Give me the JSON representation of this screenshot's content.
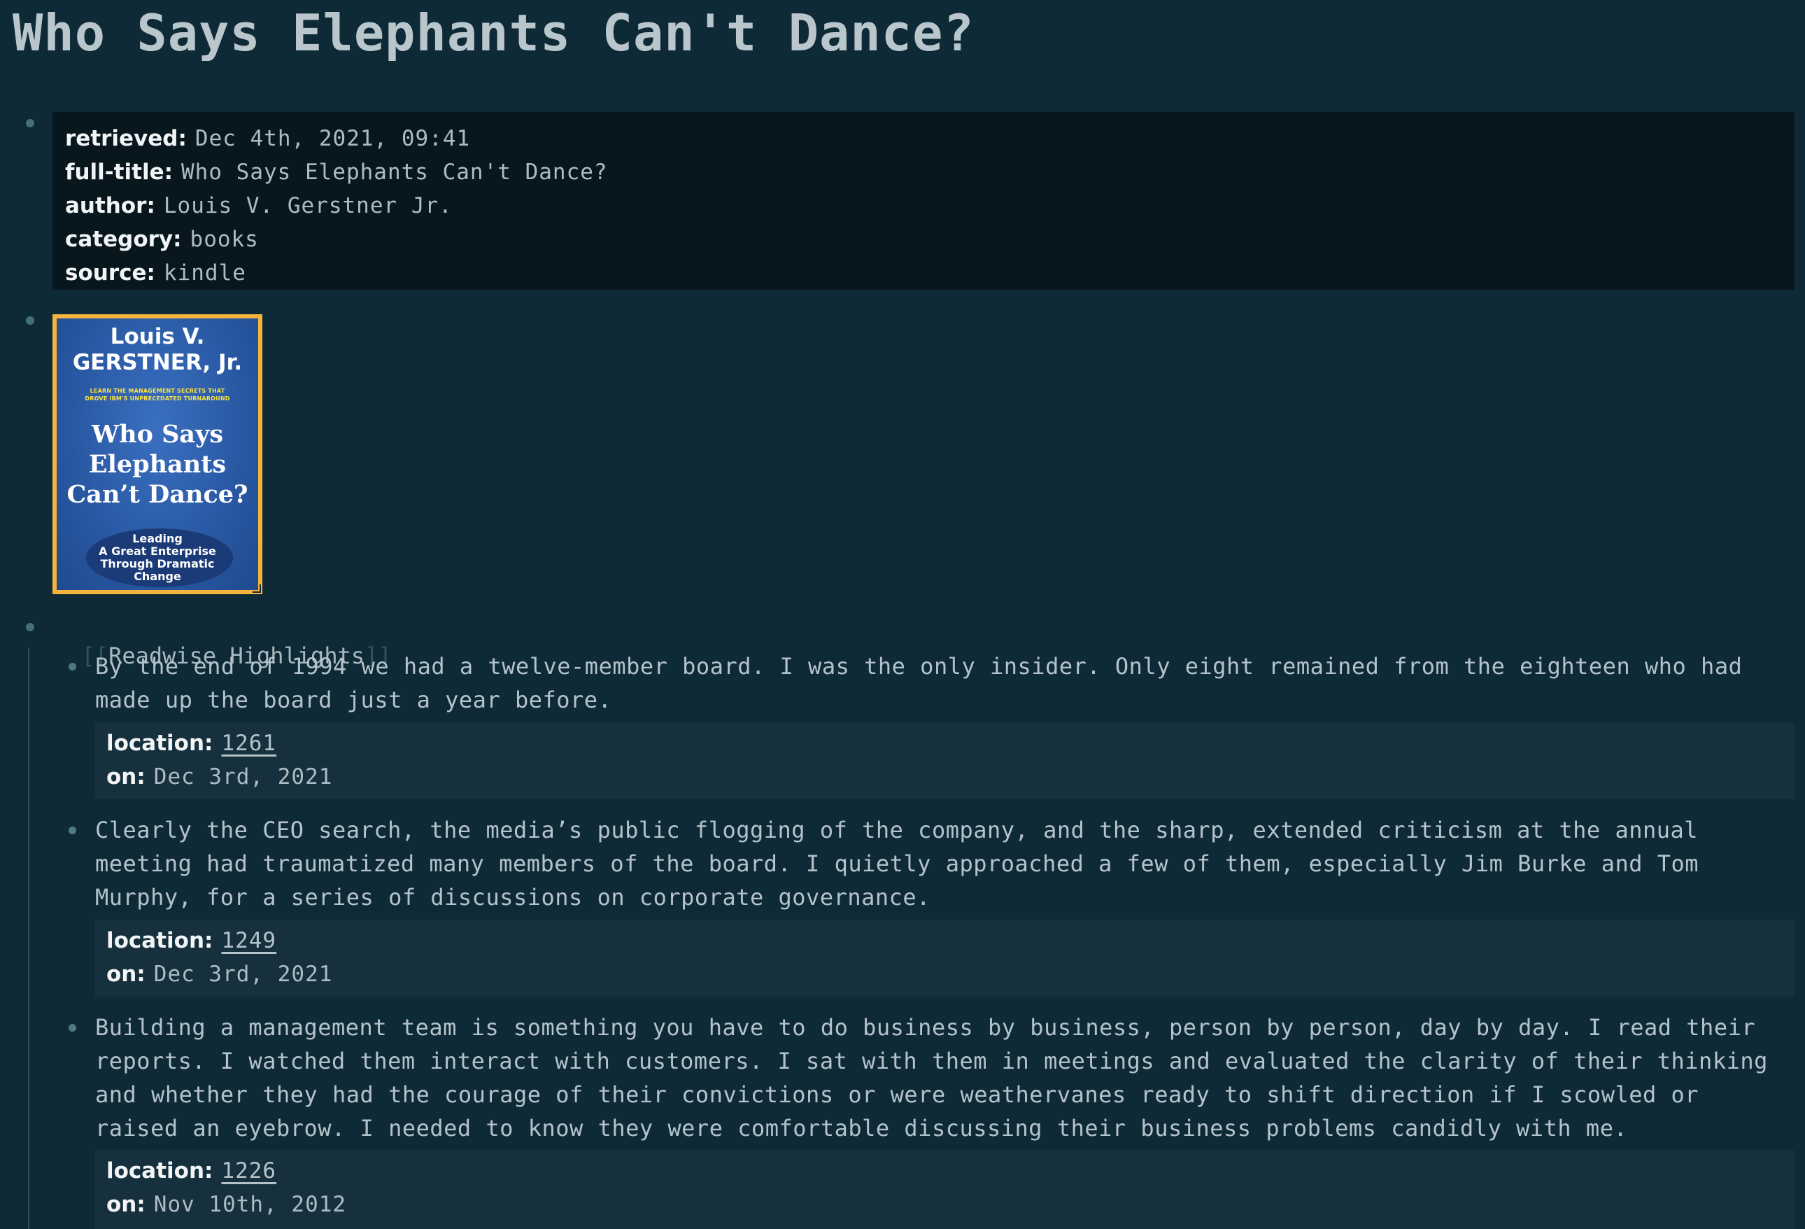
{
  "page": {
    "title": "Who Says Elephants Can't Dance?"
  },
  "properties": [
    {
      "key": "retrieved",
      "value": "Dec 4th, 2021, 09:41"
    },
    {
      "key": "full-title",
      "value": "Who Says Elephants Can't Dance?"
    },
    {
      "key": "author",
      "value": "Louis V. Gerstner Jr."
    },
    {
      "key": "category",
      "value": "books"
    },
    {
      "key": "source",
      "value": "kindle"
    }
  ],
  "cover": {
    "author_line1": "Louis V.",
    "author_line2": "GERSTNER, Jr.",
    "tagline_line1": "LEARN THE MANAGEMENT SECRETS THAT",
    "tagline_line2": "DROVE IBM'S UNPRECEDATED TURNAROUND",
    "title_line1": "Who Says",
    "title_line2": "Elephants",
    "title_line3": "Can’t Dance?",
    "subtitle_line1": "Leading",
    "subtitle_line2": "A Great Enterprise",
    "subtitle_line3": "Through Dramatic",
    "subtitle_line4": "Change",
    "frame_color": "#f3b33d",
    "background_color": "#2a5aa5"
  },
  "readwise": {
    "open_bracket": "[[",
    "label": "Readwise Highlights",
    "close_bracket": "]]"
  },
  "highlights": [
    {
      "text": "By the end of 1994 we had a twelve-member board. I was the only insider. Only eight remained from the eighteen who had made up the board just a year before.",
      "location_key": "location",
      "location": "1261",
      "on_key": "on",
      "on": "Dec 3rd, 2021"
    },
    {
      "text": "Clearly the CEO search, the media’s public flogging of the company, and the sharp, extended criticism at the annual meeting had traumatized many members of the board. I quietly approached a few of them, especially Jim Burke and Tom Murphy, for a series of discussions on corporate governance.",
      "location_key": "location",
      "location": "1249",
      "on_key": "on",
      "on": "Dec 3rd, 2021"
    },
    {
      "text": "Building a management team is something you have to do business by business, person by person, day by day. I read their reports. I watched them interact with customers. I sat with them in meetings and evaluated the clarity of their thinking and whether they had the courage of their convictions or were weathervanes ready to shift direction if I scowled or raised an eyebrow. I needed to know they were comfortable discussing their business problems candidly with me.",
      "location_key": "location",
      "location": "1226",
      "on_key": "on",
      "on": "Nov 10th, 2012"
    }
  ],
  "colors": {
    "background": "#0f2a37",
    "properties_block": "#08171e",
    "meta_block": "#16303d",
    "bullet": "#44707a"
  }
}
